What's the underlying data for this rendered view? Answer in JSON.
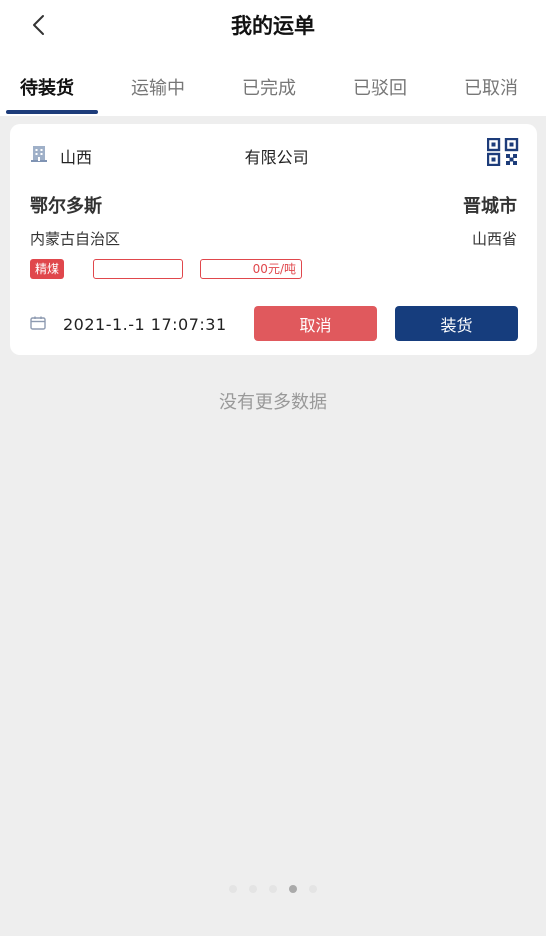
{
  "header": {
    "title": "我的运单",
    "back_icon": "chevron-left-icon"
  },
  "tabs": [
    {
      "label": "待装货",
      "active": true
    },
    {
      "label": "运输中",
      "active": false
    },
    {
      "label": "已完成",
      "active": false
    },
    {
      "label": "已驳回",
      "active": false
    },
    {
      "label": "已取消",
      "active": false
    }
  ],
  "order": {
    "company_name": "山西                              有限公司",
    "from_city": "鄂尔多斯",
    "from_province": "内蒙古自治区",
    "to_city": "晋城市",
    "to_province": "山西省",
    "tags": [
      "精煤",
      "",
      "00元/吨"
    ],
    "datetime": "2021-1.-1  17:07:31",
    "cancel_label": "取消",
    "load_label": "装货"
  },
  "list": {
    "no_more": "没有更多数据"
  },
  "page_indicator": {
    "count": 5,
    "active_index": 3
  },
  "colors": {
    "accent": "#163d7d",
    "danger": "#e0595d",
    "tag_red": "#e0474c"
  }
}
